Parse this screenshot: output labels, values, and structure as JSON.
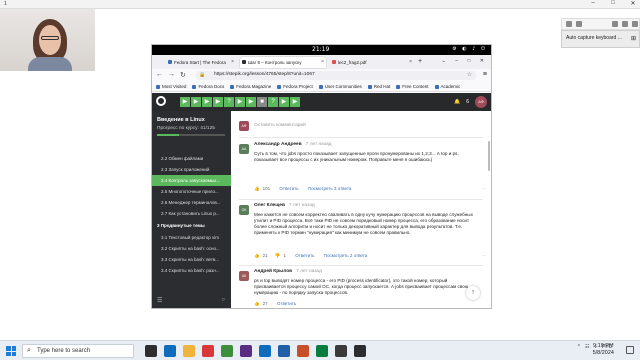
{
  "host": {
    "title": "1"
  },
  "vm": {
    "time": "21:19",
    "tabs": [
      {
        "label": "Fedora Start | The Fedora",
        "active": false,
        "color": "#3c6eb4"
      },
      {
        "label": "Шаг 8 – Контроль запуску",
        "active": true,
        "color": "#2b2d30"
      },
      {
        "label": "lec2_frag2.pdf",
        "active": false,
        "color": "#d9534f"
      }
    ],
    "url": "https://stepik.org/lesson/4765/step/8?unit=1067",
    "bookmarks": [
      "Most Visited",
      "Fedora Docs",
      "Fedora Magazine",
      "Fedora Project",
      "User Communities",
      "Red Hat",
      "Free Content",
      "Academic"
    ],
    "stepik": {
      "steps": [
        "▶",
        "▶",
        "▶",
        "▶",
        "?",
        "▶",
        "▶",
        "■",
        "?",
        "▶",
        "▶"
      ],
      "notifications": "6",
      "user_initials": "АФ",
      "course_title": "Введение в Linux",
      "progress_label": "Прогресс по курсу:",
      "progress_value": "41/125",
      "progress_fraction": 0.328,
      "lessons": [
        {
          "label": "2.2  Обмен файлами",
          "active": false
        },
        {
          "label": "2.3  Запуск приложений",
          "active": false
        },
        {
          "label": "2.4  Контроль запускаемых...",
          "active": true
        },
        {
          "label": "2.5  Многопоточные прило...",
          "active": false
        },
        {
          "label": "2.6  Менеджер терминалов...",
          "active": false
        },
        {
          "label": "2.7  Как установить Linux р...",
          "active": false
        }
      ],
      "module": "3  Продвинутые темы",
      "module_lessons": [
        {
          "label": "3.1  Текстовый редактор vim"
        },
        {
          "label": "3.2  Скрипты на bash: осно..."
        },
        {
          "label": "3.3  Скрипты на bash: ветв..."
        },
        {
          "label": "3.4  Скрипты на bash: разн..."
        }
      ],
      "compose_placeholder": "Оставить комментарий",
      "comments": [
        {
          "initials": "АА",
          "color": "#5a7d5a",
          "author": "Александр Андреев",
          "time": "7 лет назад",
          "text": "Суть в том, что jobs просто показывает запущенные проги пронумерованы их 1,2,3... А top и ps, показывает все процессы с их уникальным номером. Поправьте меня я ошибаюсь)",
          "likes": "101",
          "reply": "Ответить",
          "thread": "Посмотреть 3 ответа"
        },
        {
          "initials": "ОК",
          "color": "#5a7d5a",
          "author": "Олег Клещев",
          "time": "7 лет назад",
          "text": "Мне кажется не совсем корректно сваливать в одну кучу нумерацию процессов на выводе служебных утилит и PID процесса. Всё таки PID не совсем порядковый номер процесса, его образование носит более сложный алгоритм и носит не только декоративный характер для вывода результатов. Т.е. применять к PID термин \"нумерация\" как минимум не совсем правильно.",
          "likes": "21",
          "dislikes": "1",
          "reply": "Ответить",
          "thread": "Посмотреть 2 ответа"
        },
        {
          "initials": "АК",
          "color": "#9c5a5a",
          "author": "Андрей Крылов",
          "time": "7 лет назад",
          "text": "ps и top выводят номер процесса - его PID (process identificator), это такой номер, который присваивается процессу самой ОС, когда процесс запускается. А jobs присваивает процессам свою нумерацию - по порядку запуска процессов.",
          "likes": "27",
          "reply": "Ответить"
        }
      ]
    }
  },
  "capture": {
    "label": "Auto capture keyboard ..."
  },
  "taskbar": {
    "search_placeholder": "Type here to search",
    "icon_colors": [
      "#2e2e2e",
      "#0f6cbd",
      "#f2b33d",
      "#d9383a",
      "#3c8e3c",
      "#5a2d82",
      "#0f6cbd",
      "#1e5fa8",
      "#c94f2b",
      "#0a7d3e",
      "#3a3a3a",
      "#2b2d30"
    ],
    "lang": "РУС",
    "time": "9:19 PM",
    "date": "5/8/2024"
  }
}
